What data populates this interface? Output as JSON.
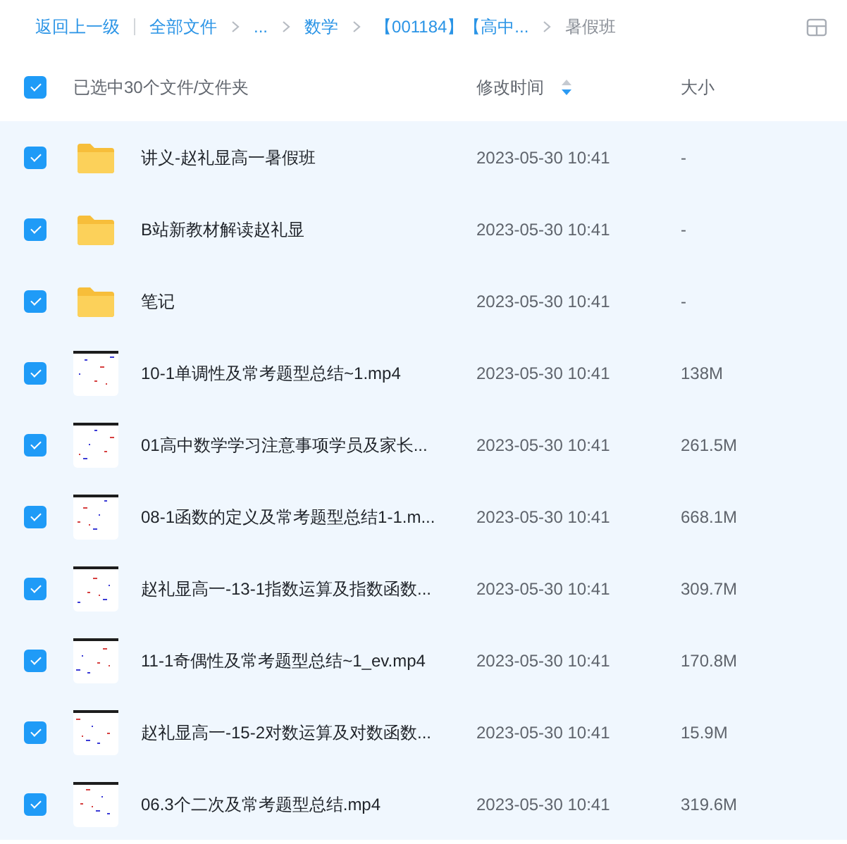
{
  "breadcrumb": {
    "back": "返回上一级",
    "items": [
      {
        "label": "全部文件",
        "current": false
      },
      {
        "label": "...",
        "current": false
      },
      {
        "label": "数学",
        "current": false
      },
      {
        "label": "【001184】【高中...",
        "current": false
      },
      {
        "label": "暑假班",
        "current": true
      }
    ]
  },
  "header": {
    "checked": true,
    "summary": "已选中30个文件/文件夹",
    "columns": [
      {
        "label": "修改时间",
        "sorted": true
      },
      {
        "label": "大小",
        "sorted": false
      }
    ]
  },
  "rows": [
    {
      "kind": "folder",
      "name": "讲义-赵礼显高一暑假班",
      "modified": "2023-05-30 10:41",
      "size": "-",
      "checked": true,
      "selected": true
    },
    {
      "kind": "folder",
      "name": "B站新教材解读赵礼显",
      "modified": "2023-05-30 10:41",
      "size": "-",
      "checked": true,
      "selected": true
    },
    {
      "kind": "folder",
      "name": "笔记",
      "modified": "2023-05-30 10:41",
      "size": "-",
      "checked": true,
      "selected": true
    },
    {
      "kind": "video",
      "name": "10-1单调性及常考题型总结~1.mp4",
      "modified": "2023-05-30 10:41",
      "size": "138M",
      "checked": true,
      "selected": true
    },
    {
      "kind": "video",
      "name": "01高中数学学习注意事项学员及家长...",
      "modified": "2023-05-30 10:41",
      "size": "261.5M",
      "checked": true,
      "selected": true
    },
    {
      "kind": "video",
      "name": "08-1函数的定义及常考题型总结1-1.m...",
      "modified": "2023-05-30 10:41",
      "size": "668.1M",
      "checked": true,
      "selected": true
    },
    {
      "kind": "video",
      "name": "赵礼显高一-13-1指数运算及指数函数...",
      "modified": "2023-05-30 10:41",
      "size": "309.7M",
      "checked": true,
      "selected": true
    },
    {
      "kind": "video",
      "name": "11-1奇偶性及常考题型总结~1_ev.mp4",
      "modified": "2023-05-30 10:41",
      "size": "170.8M",
      "checked": true,
      "selected": true
    },
    {
      "kind": "video",
      "name": "赵礼显高一-15-2对数运算及对数函数...",
      "modified": "2023-05-30 10:41",
      "size": "15.9M",
      "checked": true,
      "selected": true
    },
    {
      "kind": "video",
      "name": "06.3个二次及常考题型总结.mp4",
      "modified": "2023-05-30 10:41",
      "size": "319.6M",
      "checked": true,
      "selected": true
    }
  ]
}
